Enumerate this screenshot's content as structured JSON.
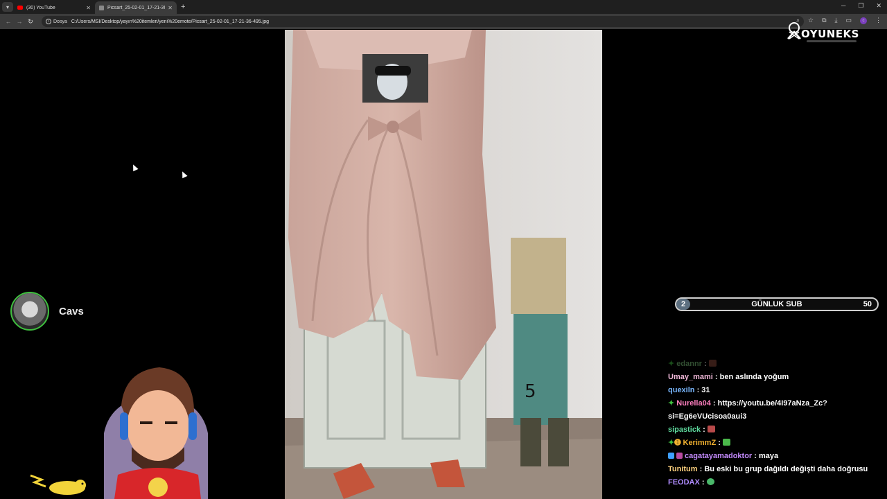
{
  "browser": {
    "tabs": [
      {
        "title": "(30) YouTube",
        "favicon": "youtube-icon",
        "active": false
      },
      {
        "title": "Picsart_25-02-01_17-21-36-495",
        "favicon": "image-icon",
        "active": true
      }
    ],
    "new_tab": "+",
    "address_chip": "Dosya",
    "url": "C:/Users/MSI/Desktop/yayın%20itemleri/yeni%20emote/Picsart_25-02-01_17-21-36-495.jpg",
    "profile_initial": "c"
  },
  "overlay": {
    "logo_text": "OYUNEKS",
    "streamer_name": "Cavs",
    "sub_goal": {
      "current": "2",
      "label": "GÜNLUK SUB",
      "target": "50",
      "progress_fraction": 0.04
    }
  },
  "chat": [
    {
      "user": "edannr",
      "color": "#7cc47c",
      "badge_color": "#3fbf3f",
      "message": "",
      "emote": true,
      "faded": true
    },
    {
      "user": "Umay_mami",
      "color": "#f0b8d8",
      "message": "ben aslında yoğum"
    },
    {
      "user": "quexiln",
      "color": "#7ab8ff",
      "message": "31"
    },
    {
      "user": "Nurella04",
      "color": "#ff7fbf",
      "badge_color": "#3fbf3f",
      "message": "https://youtu.be/4I97aNza_Zc?si=Eg6eVUcisoa0aui3"
    },
    {
      "user": "sipastick",
      "color": "#5fdc9f",
      "message": "",
      "emote": true
    },
    {
      "user": "KerimmZ",
      "color": "#f0b030",
      "badge_color": "#3fbf3f",
      "message": "",
      "emote": true
    },
    {
      "user": "cagatayamadoktor",
      "color": "#c58cff",
      "badge_color": "#3fa0ff",
      "message": "maya"
    },
    {
      "user": "Tunitum",
      "color": "#ffd27f",
      "message": "Bu eski bu grup dağıldı değişti daha doğrusu"
    },
    {
      "user": "FEODAX",
      "color": "#b08cff",
      "message": "",
      "emote": true
    }
  ]
}
